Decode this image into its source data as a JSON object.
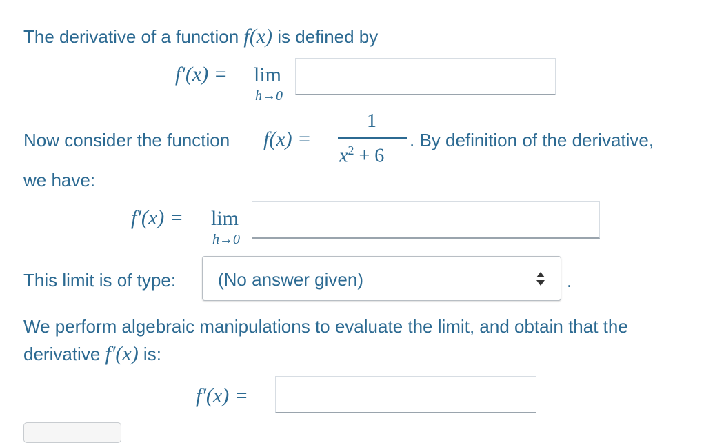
{
  "intro": {
    "text_before": "The derivative of a function ",
    "fx": "f(x)",
    "text_after": " is defined by"
  },
  "definition": {
    "lhs": "f′(x) =",
    "lim": "lim",
    "lim_sub": "h→0"
  },
  "consider": {
    "text_before": "Now consider the function ",
    "fx_eq": "f(x) =",
    "numerator": "1",
    "denominator_base": "x",
    "denominator_exp": "2",
    "denominator_rest": "+ 6",
    "text_after": ". By definition of the derivative,",
    "text_line2": "we have:"
  },
  "specific": {
    "lhs": "f′(x) =",
    "lim": "lim",
    "lim_sub": "h→0"
  },
  "limit_type": {
    "label": "This limit is of type:",
    "selected": "(No answer given)",
    "trailing": "."
  },
  "result": {
    "line1": "We perform algebraic manipulations to evaluate the limit, and obtain that the",
    "line2_before": "derivative ",
    "line2_math": "f′(x)",
    "line2_after": " is:",
    "lhs": "f′(x) ="
  },
  "colors": {
    "text": "#2c6a92",
    "input_border": "#9aa4ad",
    "background": "#ffffff"
  }
}
